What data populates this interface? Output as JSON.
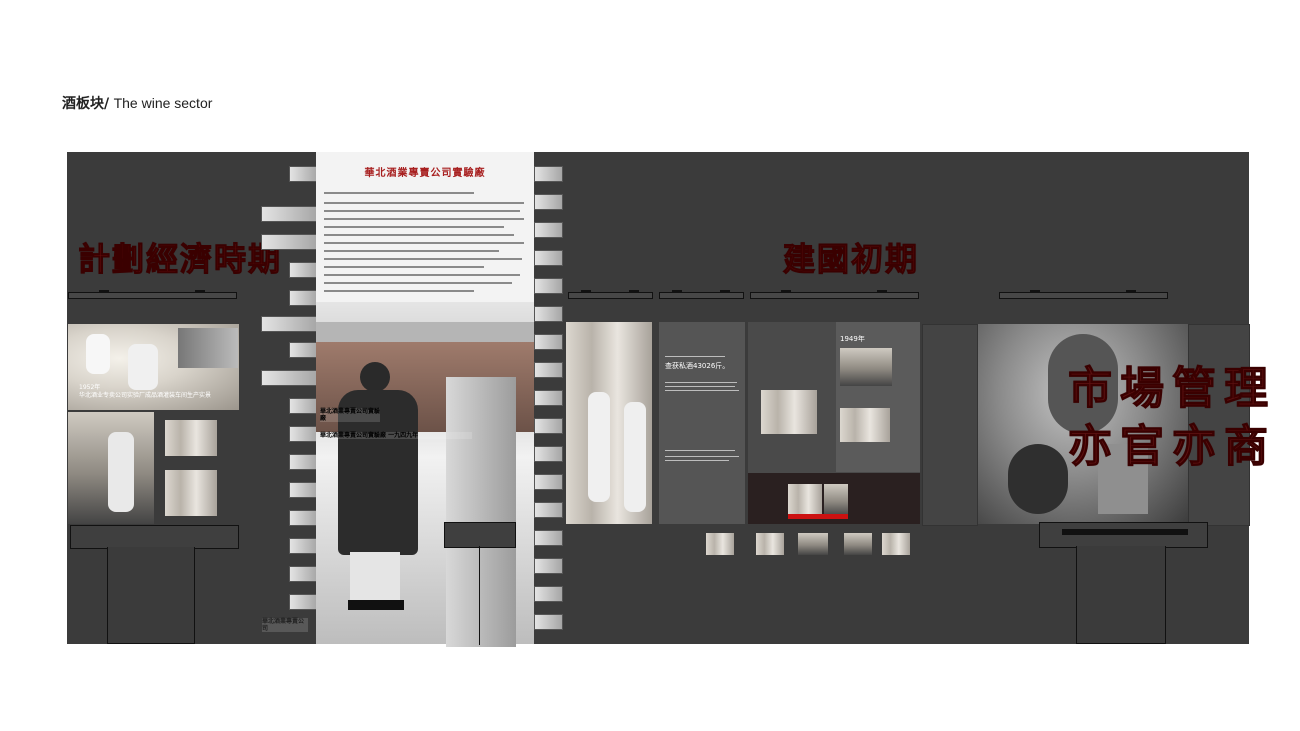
{
  "page": {
    "title_cn": "酒板块/",
    "title_en": "The wine sector"
  },
  "left_section": {
    "heading": "計劃經濟時期",
    "photo_caption_year": "1952年",
    "photo_caption_text": "华北酒业专卖公司实验厂成品酒灌装车间生产实景"
  },
  "center_column": {
    "doc_title": "華北酒業專賣公司實驗廠",
    "overlay_caption_1": "華北酒業專賣公司實驗廠",
    "overlay_caption_2": "華北酒業專賣公司實驗廠 一九四九年",
    "bottom_label": "華北酒業專賣公司"
  },
  "right_section": {
    "heading": "建國初期",
    "panel_headline": "查获私酒43026斤。",
    "panel_year": "1949年",
    "big_slogan_line1": "市場管理",
    "big_slogan_line2": "亦官亦商"
  },
  "colors": {
    "wall": "#3b3b3b",
    "calligraphy_red": "#6a1010",
    "accent_red": "#c11"
  }
}
